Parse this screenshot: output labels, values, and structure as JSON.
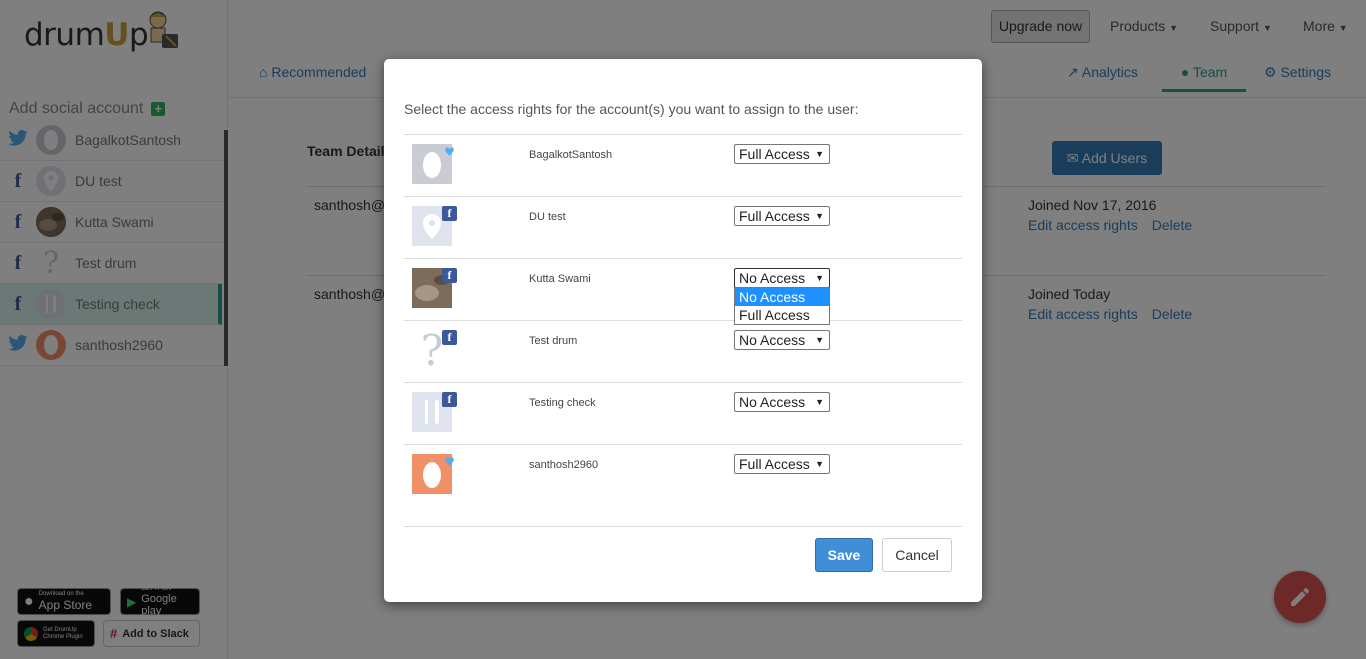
{
  "app": {
    "logo_text_pre": "drum",
    "logo_text_u": "U",
    "logo_text_post": "p"
  },
  "sidebar": {
    "add_social_label": "Add social account",
    "accounts": [
      {
        "network": "twitter",
        "name": "BagalkotSantosh"
      },
      {
        "network": "facebook",
        "name": "DU test"
      },
      {
        "network": "facebook",
        "name": "Kutta Swami"
      },
      {
        "network": "facebook",
        "name": "Test drum"
      },
      {
        "network": "facebook",
        "name": "Testing check",
        "active": true
      },
      {
        "network": "twitter",
        "name": "santhosh2960"
      }
    ],
    "badges": {
      "appstore_small": "Download on the",
      "appstore_big": "App Store",
      "googleplay_small": "GET IT ON",
      "googleplay_big": "Google play",
      "chrome_small": "Get DrumUp",
      "chrome_big": "Chrome Plugin",
      "slack": "Add to Slack"
    }
  },
  "topnav": {
    "upgrade": "Upgrade now",
    "products": "Products",
    "support": "Support",
    "more": "More",
    "tabs": {
      "recommended": "Recommended",
      "analytics": "Analytics",
      "team": "Team",
      "settings": "Settings"
    }
  },
  "team": {
    "title": "Team Detail",
    "add_users": "Add Users",
    "rows": [
      {
        "email": "santhosh@",
        "joined": "Joined Nov 17, 2016",
        "edit": "Edit access rights",
        "delete": "Delete"
      },
      {
        "email": "santhosh@",
        "joined": "Joined Today",
        "edit": "Edit access rights",
        "delete": "Delete"
      }
    ]
  },
  "modal": {
    "intro": "Select the access rights for the account(s) you want to assign to the user:",
    "rows": [
      {
        "name": "BagalkotSantosh",
        "network": "twitter",
        "access": "Full Access"
      },
      {
        "name": "DU test",
        "network": "facebook",
        "access": "Full Access"
      },
      {
        "name": "Kutta Swami",
        "network": "facebook",
        "access": "No Access"
      },
      {
        "name": "Test drum",
        "network": "facebook",
        "access": "No Access"
      },
      {
        "name": "Testing check",
        "network": "facebook",
        "access": "No Access"
      },
      {
        "name": "santhosh2960",
        "network": "twitter",
        "access": "Full Access"
      }
    ],
    "dropdown_options": [
      "No Access",
      "Full Access"
    ],
    "dropdown_selected": "No Access",
    "save": "Save",
    "cancel": "Cancel"
  },
  "colors": {
    "accent_teal": "#2a9e8f",
    "primary_blue": "#337ab7",
    "facebook": "#3b5998",
    "twitter": "#55acee",
    "fab_red": "#d9534f"
  }
}
